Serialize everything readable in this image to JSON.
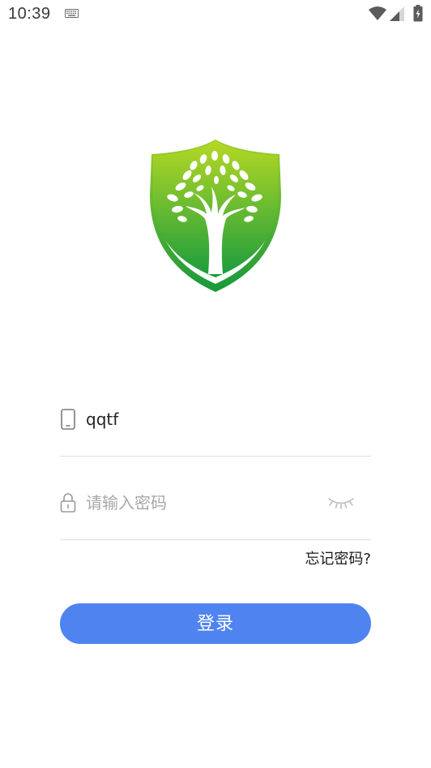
{
  "status_bar": {
    "time": "10:39",
    "icons": [
      "keyboard-icon",
      "wifi-icon",
      "signal-icon",
      "battery-icon"
    ]
  },
  "logo": {
    "icon": "tree-shield-logo",
    "colors": {
      "green_light": "#b5d824",
      "green_dark": "#1a9c3e"
    }
  },
  "login_form": {
    "username": {
      "value": "qqtf",
      "icon": "phone-icon"
    },
    "password": {
      "value": "",
      "placeholder": "请输入密码",
      "icon": "lock-icon",
      "toggle_icon": "eye-closed-icon"
    },
    "forgot_password_label": "忘记密码?",
    "login_button_label": "登录"
  },
  "colors": {
    "accent": "#4f83f0",
    "divider": "#dedede",
    "placeholder": "#a8a8a8"
  }
}
